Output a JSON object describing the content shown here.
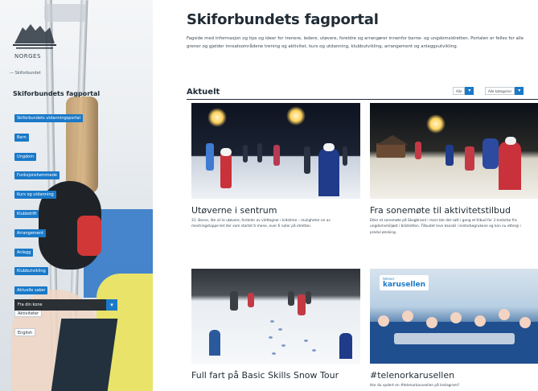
{
  "sidebar": {
    "logo_text": "NORGES",
    "logo_subtext": "SKIFORBUND",
    "back_link": "— Skiforbundet",
    "title": "Skiforbundets fagportal",
    "menu": [
      {
        "label": "Skiforbundets utdanningsportal",
        "style": "blue"
      },
      {
        "label": "Barn",
        "style": "blue"
      },
      {
        "label": "Ungdom",
        "style": "blue"
      },
      {
        "label": "Funksjonshemmede",
        "style": "blue"
      },
      {
        "label": "Kurs og utdanning",
        "style": "blue"
      },
      {
        "label": "Klubbdrift",
        "style": "blue"
      },
      {
        "label": "Arrangement",
        "style": "blue"
      },
      {
        "label": "Anlegg",
        "style": "blue"
      },
      {
        "label": "Klubbutvikling",
        "style": "blue"
      },
      {
        "label": "Aktuelle saker",
        "style": "blue"
      },
      {
        "label": "Aktiviteter",
        "style": "white"
      },
      {
        "label": "English",
        "style": "white"
      }
    ],
    "language_select": "Fra din kone",
    "select_arrow": "▾"
  },
  "main": {
    "title": "Skiforbundets fagportal",
    "intro": "Fagside med informasjon og tips og ideer for trenere, ledere, utøvere, foreldre og arrangører innenfor barne- og ungdomsidretten. Portalen er felles for alle grener og gjelder innsatsområdene trening og aktivitet, kurs og utdanning, klubbutvikling, arrangement og anleggsutvikling.",
    "section_title": "Aktuelt",
    "filters": [
      {
        "label": "Alle",
        "arrow": "▾"
      },
      {
        "label": "Alle kategorier",
        "arrow": "▾"
      }
    ],
    "cards": [
      {
        "title": "Utøverne i sentrum",
        "text": "31. Barne, lite vil le utøvere, fordeler av vildtegner i kidstime – muligheter en av mestringstoppe-tet der som startet ti mene, over 6 ruller på idretten."
      },
      {
        "title": "Fra sonemøte til aktivitetstilbud",
        "text": "Etter et sonemøte på Skogbrand i mars ble det satt i gang et tilbud for 3 kretsrbe fra ungdomsmiljøet i bilidretten. Tilbudet leve kanskil i kretsrbegrukene og kan nu ettergi i produl ønsking."
      },
      {
        "title": "Full fart på Basic Skills Snow Tour",
        "text": ""
      },
      {
        "title": "#telenorkarusellen",
        "text": "Har du vpdert en #telenorkarusellen på Instagram?",
        "image_label_small": "telenor",
        "image_label_big": "karusellen"
      }
    ]
  },
  "colors": {
    "accent": "#1a79c8",
    "text": "#1f2b35"
  }
}
